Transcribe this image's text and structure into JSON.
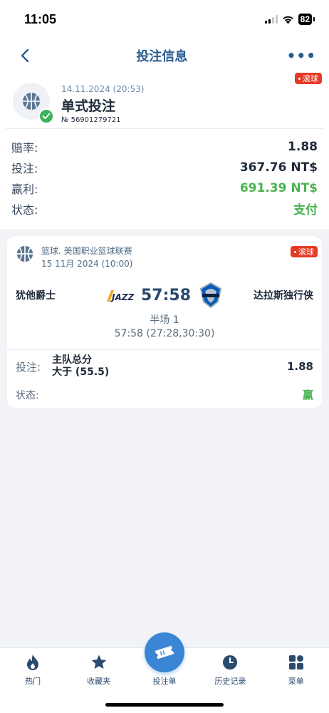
{
  "status_bar": {
    "time": "11:05",
    "battery": "82"
  },
  "nav": {
    "title": "投注信息",
    "more": "•••"
  },
  "bet": {
    "date": "14.11.2024 (20:53)",
    "type": "单式投注",
    "number": "№ 56901279721",
    "live_label": "滚球"
  },
  "summary": [
    {
      "label": "赔率:",
      "value": "1.88"
    },
    {
      "label": "投注:",
      "value": "367.76 NT$"
    },
    {
      "label": "赢利:",
      "value": "691.39 NT$"
    },
    {
      "label": "状态:",
      "value": "支付"
    }
  ],
  "event": {
    "league": "篮球. 美国职业篮球联赛",
    "date": "15 11月 2024 (10:00)",
    "live_label": "滚球",
    "home_team": "犹他爵士",
    "away_team": "达拉斯独行侠",
    "score": "57:58",
    "period": "半场 1",
    "period_score": "57:58 (27:28,30:30)",
    "pick_label": "投注:",
    "pick_line1": "主队总分",
    "pick_line2": "大于 (55.5)",
    "pick_odds": "1.88",
    "status_label": "状态:",
    "status_value": "赢"
  },
  "tabs": [
    {
      "label": "热门",
      "icon": "fire-icon"
    },
    {
      "label": "收藏夹",
      "icon": "star-icon"
    },
    {
      "label": "投注单",
      "icon": "ticket-icon"
    },
    {
      "label": "历史记录",
      "icon": "clock-icon"
    },
    {
      "label": "菜单",
      "icon": "grid-icon"
    }
  ],
  "colors": {
    "accent": "#3a86d4",
    "title": "#2a5d8f",
    "win_green": "#47b44f",
    "live_red": "#e53a25"
  }
}
